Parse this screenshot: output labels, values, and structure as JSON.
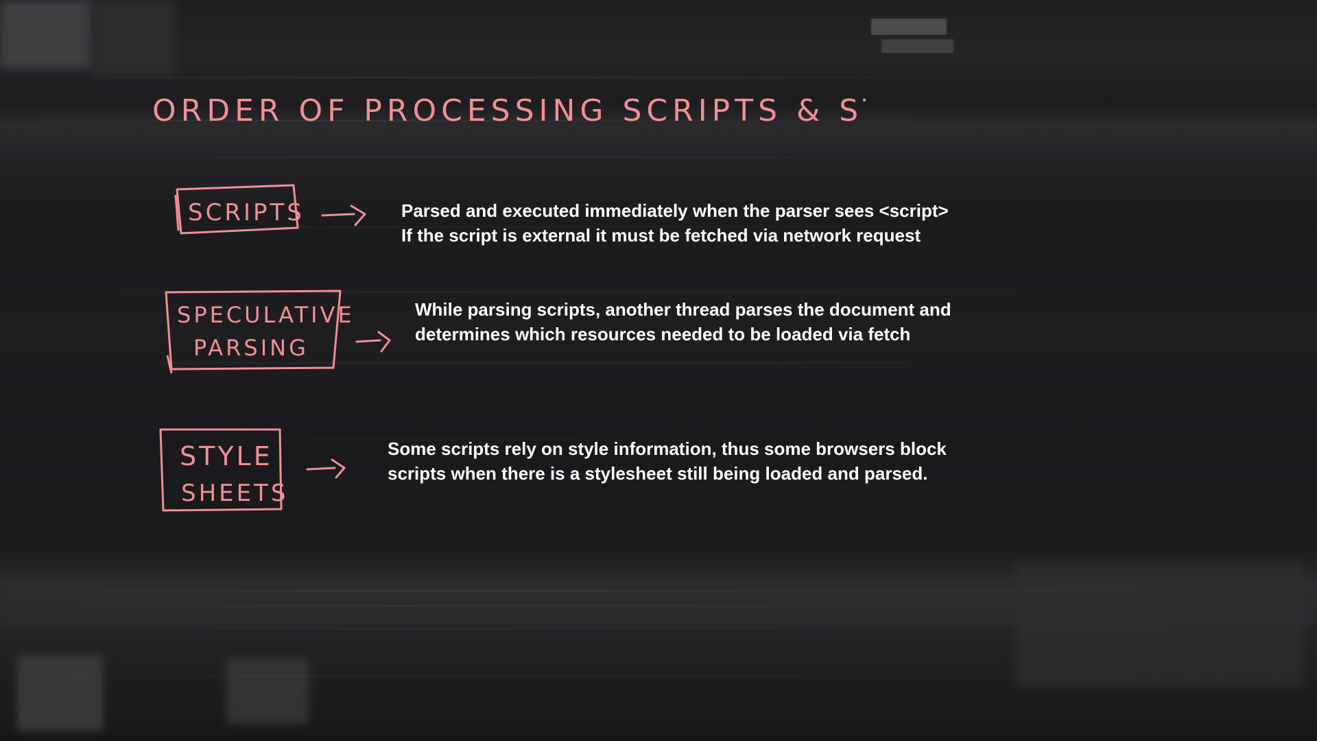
{
  "title": "ORDER OF PROCESSING SCRIPTS & STYLESHEETS",
  "colors": {
    "accent": "#f28f95",
    "text": "#ffffff",
    "background": "#1b1b1e"
  },
  "sections": [
    {
      "label_lines": [
        "SCRIPTS"
      ],
      "description_lines": [
        "Parsed and executed immediately when the parser sees <script>",
        "If the script is external it must be fetched via network request"
      ]
    },
    {
      "label_lines": [
        "SPECULATIVE",
        "PARSING"
      ],
      "description_lines": [
        "While parsing scripts, another thread parses the document and",
        "determines which resources needed to be loaded via fetch"
      ]
    },
    {
      "label_lines": [
        "STYLE",
        "SHEETS"
      ],
      "description_lines": [
        "Some scripts rely on style information, thus some browsers block",
        "scripts when there is a stylesheet still being loaded and parsed."
      ]
    }
  ],
  "icons": {
    "arrow": "arrow-right-icon"
  }
}
